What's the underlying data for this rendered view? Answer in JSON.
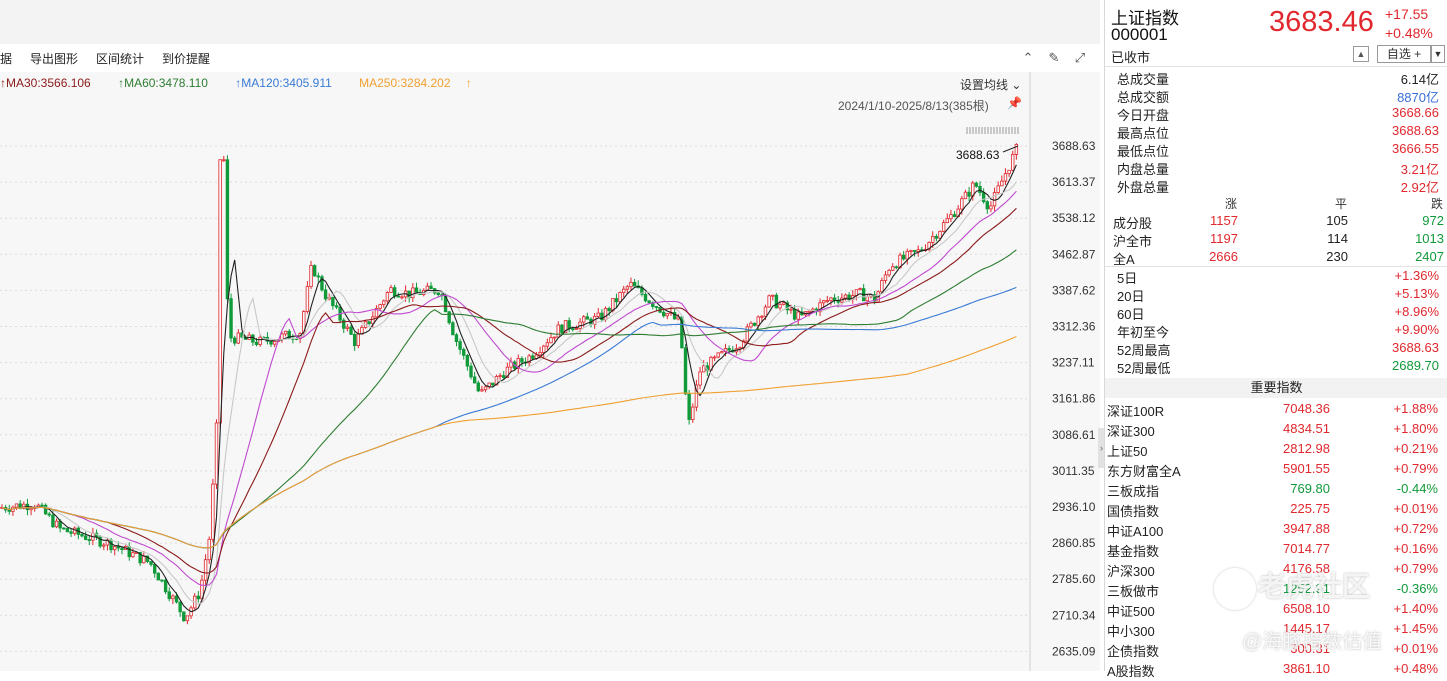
{
  "toolbar": {
    "items": [
      "据",
      "导出图形",
      "区间统计",
      "到价提醒"
    ]
  },
  "chart": {
    "ma_legend": [
      {
        "label": "MA30:3566.106",
        "arrow": "↑",
        "color": "#8b1a1a"
      },
      {
        "label": "MA60:3478.110",
        "arrow": "↑",
        "color": "#2e7d32"
      },
      {
        "label": "MA120:3405.911",
        "arrow": "↑",
        "color": "#3a7bd5"
      },
      {
        "label": "MA250:3284.202",
        "arrow": "↑",
        "color": "#f0a030"
      }
    ],
    "set_ma_label": "设置均线",
    "date_range": "2024/1/10-2025/8/13(385根)",
    "high_annotation": "3688.63",
    "y_ticks": [
      "3688.63",
      "3613.37",
      "3538.12",
      "3462.87",
      "3387.62",
      "3312.36",
      "3237.11",
      "3161.86",
      "3086.61",
      "3011.35",
      "2936.10",
      "2860.85",
      "2785.60",
      "2710.34",
      "2635.09"
    ],
    "colors": {
      "up": "#e0282e",
      "down": "#109a3a",
      "ma5": "#222222",
      "ma10": "#c8c8c8",
      "ma20": "#c04ad0",
      "ma30": "#8b1a1a",
      "ma60": "#2e7d32",
      "ma120": "#3a7bd5",
      "ma250": "#f0a030"
    }
  },
  "panel": {
    "name": "上证指数",
    "code": "000001",
    "status": "已收市",
    "price": "3683.46",
    "change": "+17.55",
    "change_pct": "+0.48%",
    "fav_label": "自选 +",
    "stats": [
      {
        "label": "总成交量",
        "value": "6.14亿",
        "color": "dark"
      },
      {
        "label": "总成交额",
        "value": "8870亿",
        "color": "blue"
      },
      {
        "label": "今日开盘",
        "value": "3668.66",
        "color": "red"
      },
      {
        "label": "最高点位",
        "value": "3688.63",
        "color": "red"
      },
      {
        "label": "最低点位",
        "value": "3666.55",
        "color": "red"
      },
      {
        "label": "内盘总量",
        "value": "3.21亿",
        "color": "red"
      },
      {
        "label": "外盘总量",
        "value": "2.92亿",
        "color": "red"
      }
    ],
    "breadth_header": {
      "up": "涨",
      "flat": "平",
      "down": "跌"
    },
    "breadth": [
      {
        "label": "成分股",
        "up": "1157",
        "flat": "105",
        "down": "972"
      },
      {
        "label": "沪全市",
        "up": "1197",
        "flat": "114",
        "down": "1013"
      },
      {
        "label": "全A",
        "up": "2666",
        "flat": "230",
        "down": "2407"
      }
    ],
    "periods": [
      {
        "label": "5日",
        "value": "+1.36%",
        "color": "red"
      },
      {
        "label": "20日",
        "value": "+5.13%",
        "color": "red"
      },
      {
        "label": "60日",
        "value": "+8.96%",
        "color": "red"
      },
      {
        "label": "年初至今",
        "value": "+9.90%",
        "color": "red"
      },
      {
        "label": "52周最高",
        "value": "3688.63",
        "color": "red"
      },
      {
        "label": "52周最低",
        "value": "2689.70",
        "color": "green"
      }
    ],
    "important_header": "重要指数",
    "important": [
      {
        "name": "深证100R",
        "value": "7048.36",
        "pct": "+1.88%",
        "vcolor": "red",
        "pcolor": "red"
      },
      {
        "name": "深证300",
        "value": "4834.51",
        "pct": "+1.80%",
        "vcolor": "red",
        "pcolor": "red"
      },
      {
        "name": "上证50",
        "value": "2812.98",
        "pct": "+0.21%",
        "vcolor": "red",
        "pcolor": "red"
      },
      {
        "name": "东方财富全A",
        "value": "5901.55",
        "pct": "+0.79%",
        "vcolor": "red",
        "pcolor": "red"
      },
      {
        "name": "三板成指",
        "value": "769.80",
        "pct": "-0.44%",
        "vcolor": "green",
        "pcolor": "green"
      },
      {
        "name": "国债指数",
        "value": "225.75",
        "pct": "+0.01%",
        "vcolor": "red",
        "pcolor": "red"
      },
      {
        "name": "中证A100",
        "value": "3947.88",
        "pct": "+0.72%",
        "vcolor": "red",
        "pcolor": "red"
      },
      {
        "name": "基金指数",
        "value": "7014.77",
        "pct": "+0.16%",
        "vcolor": "red",
        "pcolor": "red"
      },
      {
        "name": "沪深300",
        "value": "4176.58",
        "pct": "+0.79%",
        "vcolor": "red",
        "pcolor": "red"
      },
      {
        "name": "三板做市",
        "value": "1252.91",
        "pct": "-0.36%",
        "vcolor": "green",
        "pcolor": "green"
      },
      {
        "name": "中证500",
        "value": "6508.10",
        "pct": "+1.40%",
        "vcolor": "red",
        "pcolor": "red"
      },
      {
        "name": "中小300",
        "value": "1445.17",
        "pct": "+1.45%",
        "vcolor": "red",
        "pcolor": "red"
      },
      {
        "name": "企债指数",
        "value": "300.31",
        "pct": "+0.01%",
        "vcolor": "red",
        "pcolor": "red"
      },
      {
        "name": "A股指数",
        "value": "3861.10",
        "pct": "+0.48%",
        "vcolor": "red",
        "pcolor": "red"
      }
    ]
  },
  "watermark": {
    "text1": "老虎社区",
    "text2": "@海豚指数估值"
  }
}
